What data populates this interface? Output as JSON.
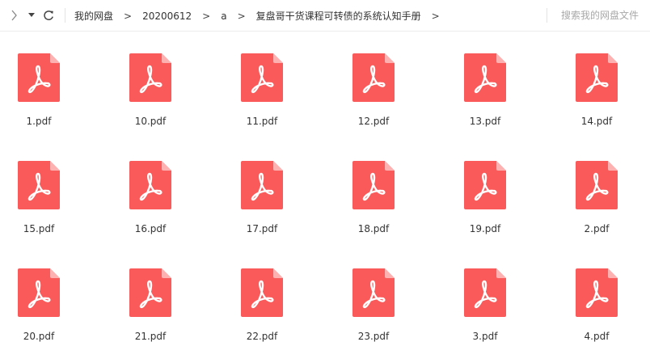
{
  "toolbar": {
    "back_icon": "chevron-left-icon",
    "history_icon": "caret-down-icon",
    "refresh_icon": "refresh-icon",
    "breadcrumb": [
      "我的网盘",
      "20200612",
      "a",
      "复盘哥干货课程可转债的系统认知手册"
    ],
    "breadcrumb_separator": ">",
    "search_placeholder": "搜索我的网盘文件"
  },
  "files": [
    {
      "name": "1.pdf",
      "icon": "pdf-file-icon"
    },
    {
      "name": "10.pdf",
      "icon": "pdf-file-icon"
    },
    {
      "name": "11.pdf",
      "icon": "pdf-file-icon"
    },
    {
      "name": "12.pdf",
      "icon": "pdf-file-icon"
    },
    {
      "name": "13.pdf",
      "icon": "pdf-file-icon"
    },
    {
      "name": "14.pdf",
      "icon": "pdf-file-icon"
    },
    {
      "name": "15.pdf",
      "icon": "pdf-file-icon"
    },
    {
      "name": "16.pdf",
      "icon": "pdf-file-icon"
    },
    {
      "name": "17.pdf",
      "icon": "pdf-file-icon"
    },
    {
      "name": "18.pdf",
      "icon": "pdf-file-icon"
    },
    {
      "name": "19.pdf",
      "icon": "pdf-file-icon"
    },
    {
      "name": "2.pdf",
      "icon": "pdf-file-icon"
    },
    {
      "name": "20.pdf",
      "icon": "pdf-file-icon"
    },
    {
      "name": "21.pdf",
      "icon": "pdf-file-icon"
    },
    {
      "name": "22.pdf",
      "icon": "pdf-file-icon"
    },
    {
      "name": "23.pdf",
      "icon": "pdf-file-icon"
    },
    {
      "name": "3.pdf",
      "icon": "pdf-file-icon"
    },
    {
      "name": "4.pdf",
      "icon": "pdf-file-icon"
    }
  ],
  "colors": {
    "pdf_icon": "#fa5a5a",
    "pdf_icon_fold": "#fdb1b1"
  }
}
